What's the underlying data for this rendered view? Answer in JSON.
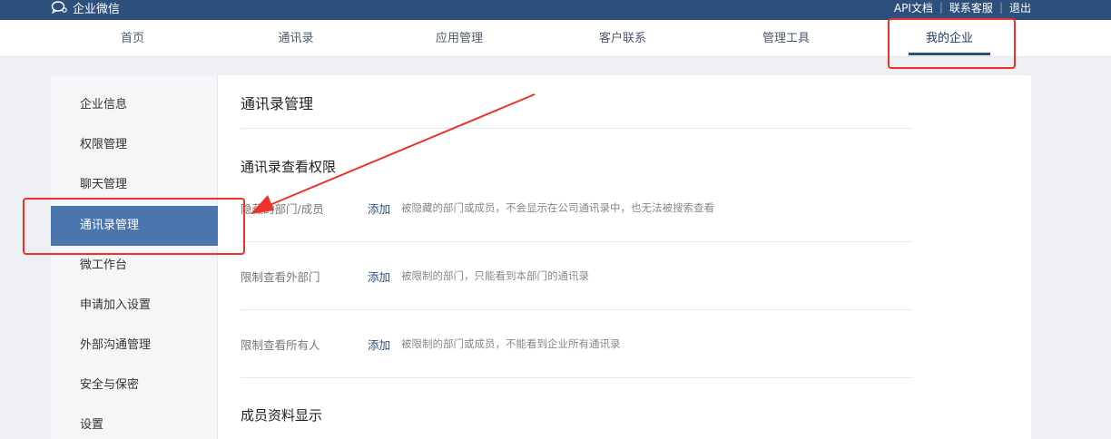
{
  "topbar": {
    "brand": "企业微信",
    "links": [
      "API文档",
      "联系客服",
      "退出"
    ],
    "separator": "|"
  },
  "nav": {
    "items": [
      "首页",
      "通讯录",
      "应用管理",
      "客户联系",
      "管理工具",
      "我的企业"
    ],
    "active": "我的企业"
  },
  "sidebar": {
    "items": [
      "企业信息",
      "权限管理",
      "聊天管理",
      "通讯录管理",
      "微工作台",
      "申请加入设置",
      "外部沟通管理",
      "安全与保密",
      "设置"
    ],
    "active": "通讯录管理"
  },
  "main": {
    "title": "通讯录管理",
    "section1": {
      "title": "通讯录查看权限",
      "rows": [
        {
          "label": "隐藏的部门/成员",
          "action": "添加",
          "desc": "被隐藏的部门或成员，不会显示在公司通讯录中，也无法被搜索查看"
        },
        {
          "label": "限制查看外部门",
          "action": "添加",
          "desc": "被限制的部门，只能看到本部门的通讯录"
        },
        {
          "label": "限制查看所有人",
          "action": "添加",
          "desc": "被限制的部门或成员，不能看到企业所有通讯录"
        }
      ]
    },
    "section2": {
      "title": "成员资料显示"
    }
  },
  "colors": {
    "topbar": "#2d4f7c",
    "active_sidebar": "#4a75ad",
    "annotation": "#f0302a"
  }
}
